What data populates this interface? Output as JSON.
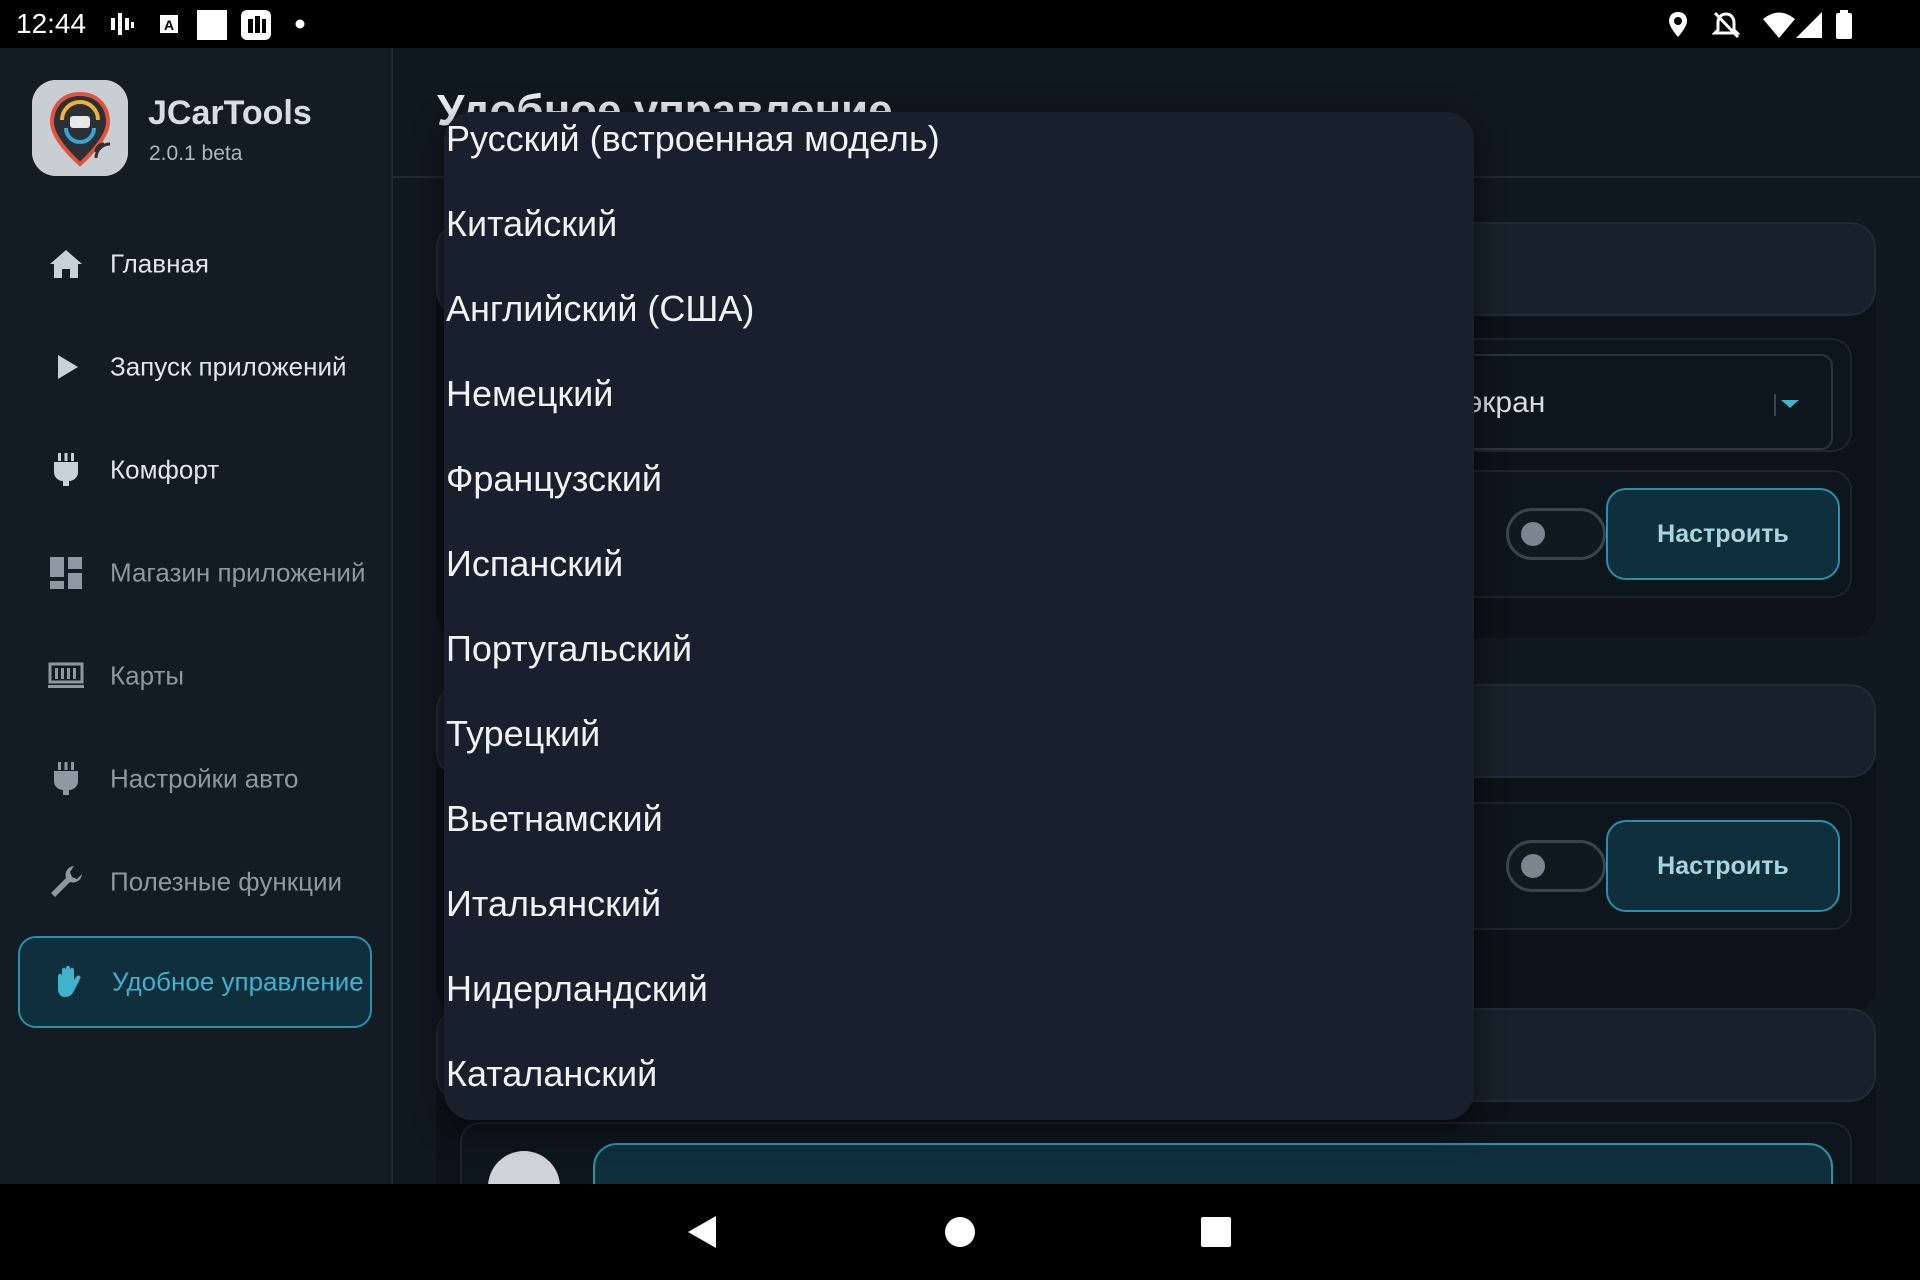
{
  "status_bar": {
    "time": "12:44",
    "left_icons": [
      "signal-bars-icon",
      "a-badge-icon",
      "white-square-icon",
      "app-notification-icon",
      "dot-icon"
    ],
    "right_icons": [
      "location-icon",
      "do-not-disturb-icon",
      "wifi-icon",
      "cell-signal-icon",
      "battery-icon"
    ]
  },
  "app": {
    "name": "JCarTools",
    "version": "2.0.1 beta"
  },
  "sidebar": {
    "items": [
      {
        "label": "Главная",
        "icon": "home-icon"
      },
      {
        "label": "Запуск приложений",
        "icon": "play-icon"
      },
      {
        "label": "Комфорт",
        "icon": "plug-icon"
      },
      {
        "label": "Магазин приложений",
        "icon": "dashboard-icon"
      },
      {
        "label": "Карты",
        "icon": "map-icon"
      },
      {
        "label": "Настройки авто",
        "icon": "plug-icon"
      },
      {
        "label": "Полезные функции",
        "icon": "wrench-icon"
      },
      {
        "label": "Удобное управление",
        "icon": "hand-icon",
        "active": true
      }
    ]
  },
  "main": {
    "title": "Удобное управление",
    "select_value": "экран",
    "configure_label": "Настроить"
  },
  "dropdown": {
    "options": [
      "Русский (встроенная модель)",
      "Китайский",
      "Английский (США)",
      "Немецкий",
      "Французский",
      "Испанский",
      "Португальский",
      "Турецкий",
      "Вьетнамский",
      "Итальянский",
      "Нидерландский",
      "Каталанский"
    ]
  },
  "nav_bar": {
    "icons": [
      "back-icon",
      "home-circle-icon",
      "recents-icon"
    ]
  },
  "colors": {
    "accent": "#2a8fa8",
    "accent_text": "#3fb2cc",
    "background": "#101820",
    "dropdown_bg": "#17202c"
  }
}
